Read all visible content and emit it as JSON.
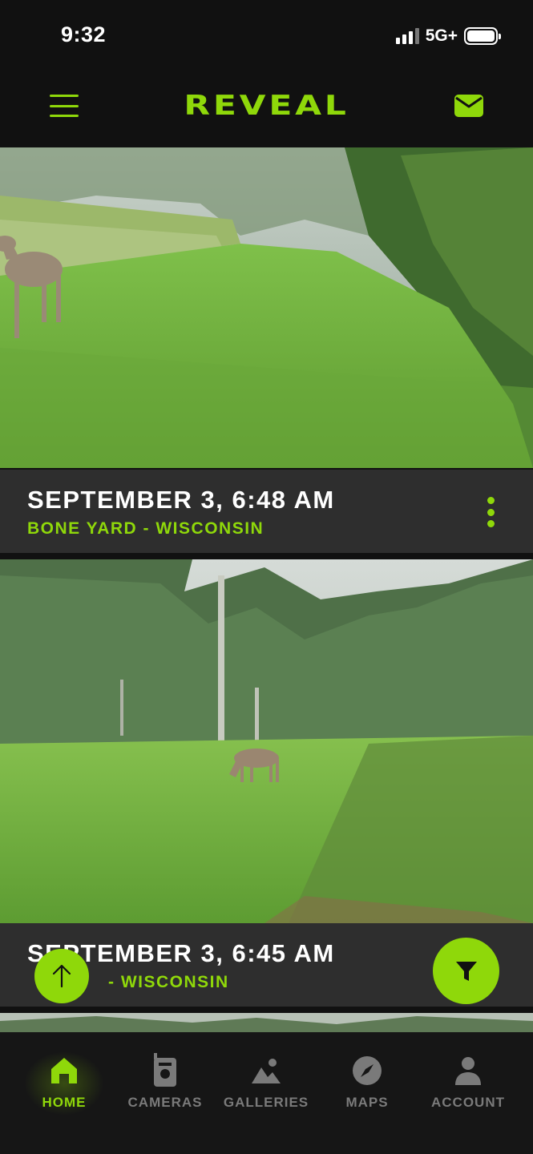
{
  "status_bar": {
    "time": "9:32",
    "network": "5G+"
  },
  "header": {
    "logo_text": "REVEAL"
  },
  "feed": {
    "items": [
      {
        "title": "SEPTEMBER 3, 6:48 AM",
        "location": "BONE YARD - WISCONSIN"
      },
      {
        "title": "SEPTEMBER 3, 6:45 AM",
        "location": "- WISCONSIN"
      }
    ]
  },
  "bottom_nav": {
    "items": [
      {
        "label": "HOME",
        "icon": "home-icon",
        "active": true
      },
      {
        "label": "CAMERAS",
        "icon": "camera-icon",
        "active": false
      },
      {
        "label": "GALLERIES",
        "icon": "gallery-icon",
        "active": false
      },
      {
        "label": "MAPS",
        "icon": "compass-icon",
        "active": false
      },
      {
        "label": "ACCOUNT",
        "icon": "account-icon",
        "active": false
      }
    ]
  },
  "colors": {
    "accent": "#8fd80a",
    "background": "#111111",
    "caption_bg": "#2e2e2e",
    "inactive": "#7a7a7a"
  }
}
